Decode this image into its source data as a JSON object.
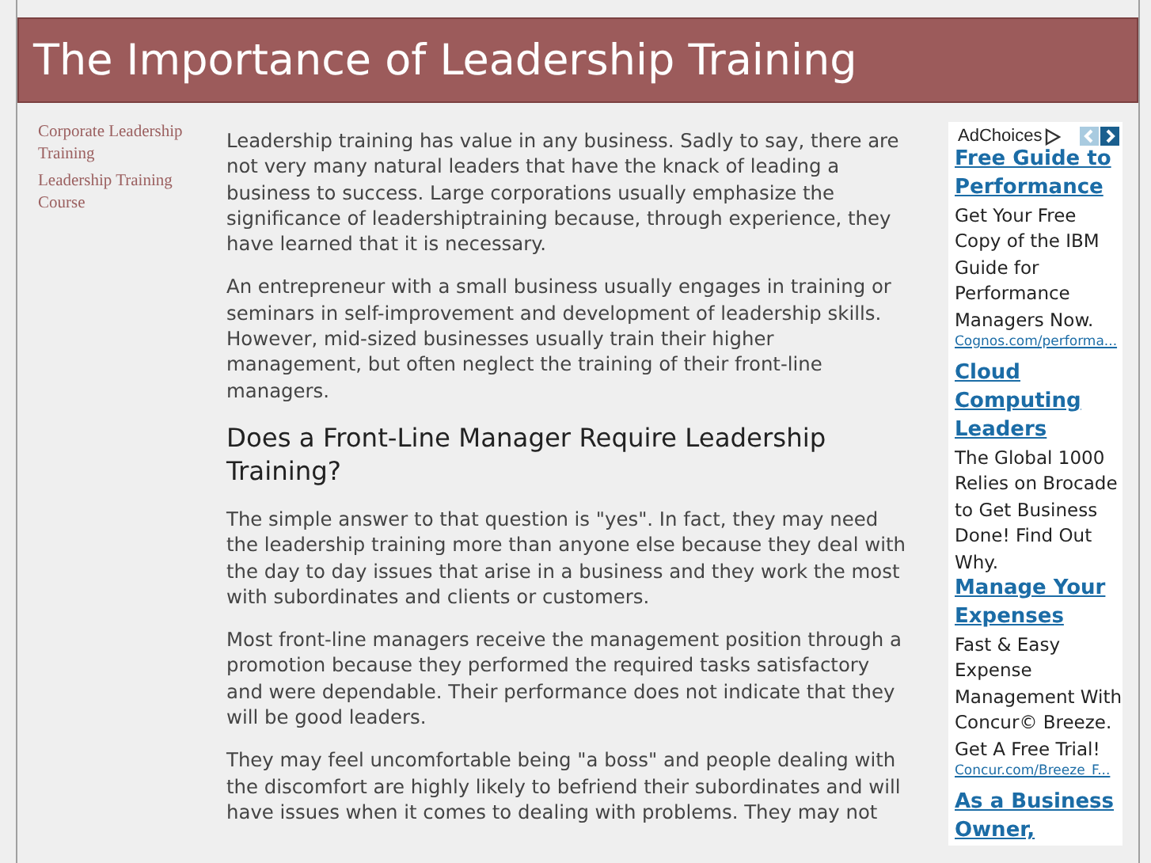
{
  "header": {
    "title": "The Importance of Leadership Training"
  },
  "sidebar": {
    "links": [
      "Corporate Leadership Training",
      "Leadership Training Course"
    ]
  },
  "article": {
    "blocks": [
      {
        "kind": "paragraph",
        "text": "Leadership training has value in any business. Sadly to say, there are not very many natural leaders that have the knack of leading a business to success. Large corporations usually emphasize the significance of leadershiptraining because, through experience, they have learned that it is necessary."
      },
      {
        "kind": "paragraph",
        "text": "An entrepreneur with a small business usually engages in training or seminars in self-improvement and development of leadership skills. However, mid-sized businesses usually train their higher management, but often neglect the training of their front-line managers."
      },
      {
        "kind": "heading",
        "text": "Does a Front-Line Manager Require Leadership Training?"
      },
      {
        "kind": "paragraph",
        "text": "The simple answer to that question is \"yes\". In fact, they may need the leadership training more than anyone else because they deal with the day to day issues that arise in a business and they work the most with subordinates and clients or customers."
      },
      {
        "kind": "paragraph",
        "text": "Most front-line managers receive the management position through a promotion because they performed the required tasks satisfactory and were dependable. Their performance does not indicate that they will be good leaders."
      },
      {
        "kind": "paragraph",
        "text": "They may feel uncomfortable being \"a boss\" and people dealing with the discomfort are highly likely to befriend their subordinates and will have issues when it comes to dealing with problems. They may not"
      }
    ]
  },
  "ads": {
    "label": "AdChoices",
    "items": [
      {
        "title": "Free Guide to Performance",
        "body": "Get Your Free Copy of the IBM Guide for Performance Managers Now.",
        "url": "Cognos.com/performa..."
      },
      {
        "title": "Cloud Computing Leaders",
        "body": "The Global 1000 Relies on Brocade to Get Business Done! Find Out Why."
      },
      {
        "title": "Manage Your Expenses",
        "body": "Fast & Easy Expense Management With Concur© Breeze. Get A Free Trial!",
        "url": "Concur.com/Breeze_F..."
      },
      {
        "title": "As a Business Owner,"
      }
    ]
  }
}
